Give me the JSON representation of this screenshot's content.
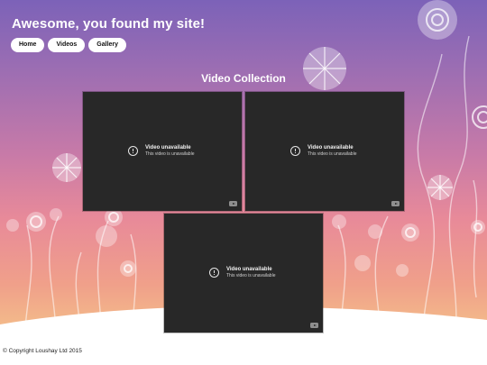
{
  "site": {
    "title": "Awesome, you found my site!"
  },
  "nav": {
    "items": [
      {
        "label": "Home"
      },
      {
        "label": "Videos"
      },
      {
        "label": "Gallery"
      }
    ]
  },
  "main": {
    "heading": "Video Collection",
    "videos": [
      {
        "title": "Video unavailable",
        "subtitle": "This video is unavailable",
        "icon": "warning-icon"
      },
      {
        "title": "Video unavailable",
        "subtitle": "This video is unavailable",
        "icon": "warning-icon"
      },
      {
        "title": "Video unavailable",
        "subtitle": "This video is unavailable",
        "icon": "warning-icon"
      }
    ]
  },
  "footer": {
    "copyright": "© Copyright Loushay Ltd 2015"
  },
  "colors": {
    "background_top": "#7c62b8",
    "background_bottom": "#f7d39a",
    "player": "#282828",
    "nav_button": "#ffffff"
  }
}
